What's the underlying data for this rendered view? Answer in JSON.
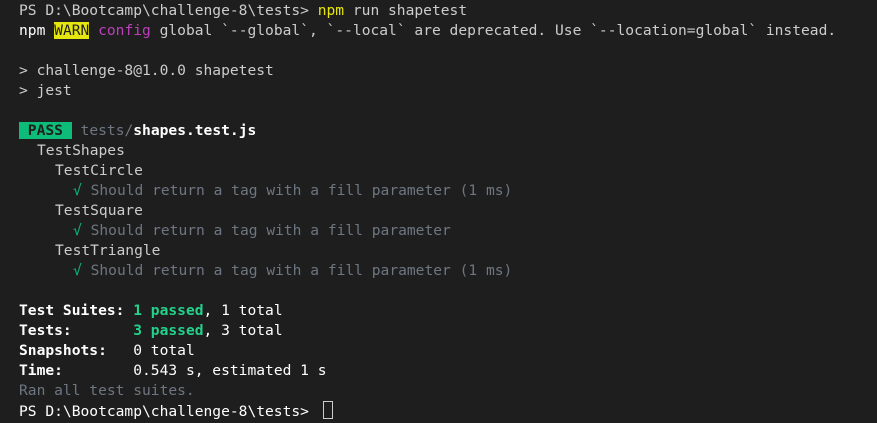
{
  "prompt1": {
    "text": "PS D:\\Bootcamp\\challenge-8\\tests> ",
    "cmd": "npm",
    "args": " run shapetest"
  },
  "warn": {
    "npm": "npm",
    "label": "WARN",
    "config": "config",
    "message": " global `--global`, `--local` are deprecated. Use `--location=global` instead."
  },
  "script_header": "> challenge-8@1.0.0 shapetest",
  "script_cmd": "> jest",
  "result": {
    "badge": "PASS",
    "path_dir": "tests/",
    "path_file": "shapes.test.js"
  },
  "suite": {
    "name": "TestShapes",
    "groups": [
      {
        "name": "TestCircle",
        "check": "√",
        "test": "Should return a tag with a fill parameter",
        "time": " (1 ms)"
      },
      {
        "name": "TestSquare",
        "check": "√",
        "test": "Should return a tag with a fill parameter",
        "time": ""
      },
      {
        "name": "TestTriangle",
        "check": "√",
        "test": "Should return a tag with a fill parameter",
        "time": " (1 ms)"
      }
    ]
  },
  "summary": {
    "suites_label": "Test Suites:",
    "suites_passed": "1 passed",
    "suites_total": ", 1 total",
    "tests_label": "Tests:",
    "tests_passed": "3 passed",
    "tests_total": ", 3 total",
    "snapshots_label": "Snapshots:",
    "snapshots_value": "0 total",
    "time_label": "Time:",
    "time_value": "0.543 s, estimated 1 s",
    "ran_all": "Ran all test suites."
  },
  "prompt2": {
    "text": "PS D:\\Bootcamp\\challenge-8\\tests> "
  }
}
